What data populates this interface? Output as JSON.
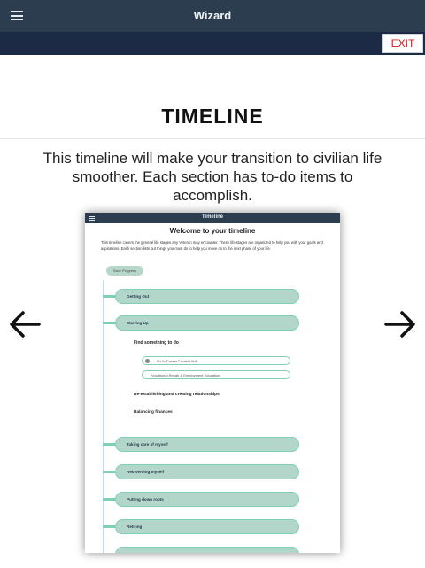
{
  "header": {
    "title": "Wizard",
    "menu_icon": "hamburger-menu-icon"
  },
  "subbar": {
    "exit_label": "EXIT",
    "exit_color": "#e01616"
  },
  "page": {
    "heading": "TIMELINE",
    "description": "This timeline will make your transition to civilian life smoother. Each section has to-do items to accomplish.",
    "prev_icon": "arrow-left-icon",
    "next_icon": "arrow-right-icon"
  },
  "preview": {
    "app_title": "Timeline",
    "welcome": "Welcome to your timeline",
    "intro": "This timeline covers the general life stages any Veteran may encounter. These life stages are organized to help you with your goals and aspirations. Each section lists out things you must do to help you move on to the next phase of your life.",
    "save_label": "Save Progress",
    "stages_top": [
      "Getting Out",
      "Starting Up"
    ],
    "subhead": "Find something to do",
    "tasks": [
      "Go to Career Center Visit",
      "Vocational Rehab & Employment Education"
    ],
    "extra_items": [
      "Re-establishing and creating relationships",
      "Balancing finances"
    ],
    "stages_bottom": [
      "Taking care of myself",
      "Reinventing myself",
      "Putting down roots",
      "Retiring"
    ]
  },
  "colors": {
    "topbar": "#2b3d4f",
    "subbar": "#1d2a45",
    "stage_fill": "#b2d6ca",
    "stage_border": "#7fcfb8"
  }
}
